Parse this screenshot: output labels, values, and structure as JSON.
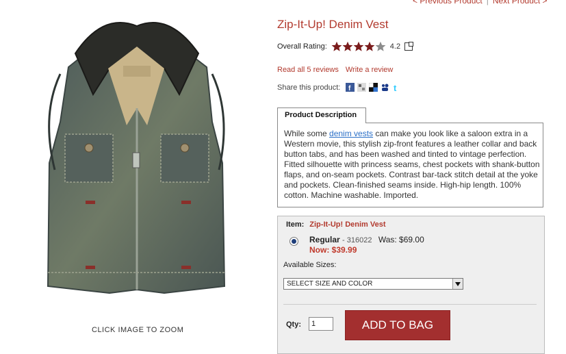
{
  "nav": {
    "previous": "< Previous Product",
    "next": "Next Product >"
  },
  "product": {
    "title": "Zip-It-Up! Denim Vest",
    "rating_label": "Overall Rating:",
    "rating_value": "4.2",
    "rating_stars": 4.2,
    "read_reviews": "Read all 5 reviews",
    "write_review": "Write a review",
    "share_label": "Share this product:",
    "zoom_hint": "CLICK IMAGE TO ZOOM"
  },
  "description": {
    "tab_label": "Product Description",
    "text_before_link": "While some ",
    "link_text": "denim vests",
    "text_after_link": " can make you look like a saloon extra in a Western movie, this stylish zip-front features a leather collar and back button tabs, and has been washed and tinted to vintage perfection. Fitted silhouette with princess seams, chest pockets with shank-button flaps, and on-seam pockets. Contrast bar-tack stitch detail at the yoke and pockets. Clean-finished seams inside. High-hip length. 100% cotton. Machine washable. Imported."
  },
  "purchase": {
    "item_label": "Item:",
    "item_name": "Zip-It-Up! Denim Vest",
    "variant_name": "Regular",
    "variant_sku": "- 316022",
    "was_price": "Was: $69.00",
    "now_price": "Now: $39.99",
    "sizes_label": "Available Sizes:",
    "size_select_value": "SELECT SIZE AND COLOR",
    "qty_label": "Qty:",
    "qty_value": "1",
    "add_button": "ADD TO BAG"
  },
  "colors": {
    "accent": "#b23a2e",
    "button": "#a32f2f",
    "link": "#2a6fc7"
  },
  "share_icons": [
    "facebook-icon",
    "digg-icon",
    "delicious-icon",
    "myspace-icon",
    "twitter-icon"
  ]
}
